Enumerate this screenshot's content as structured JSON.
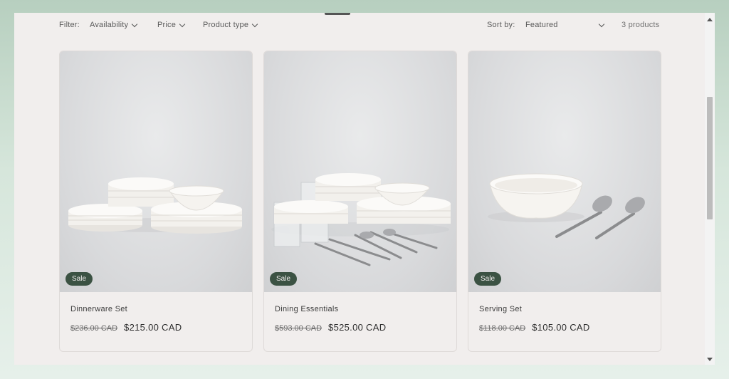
{
  "filters": {
    "label": "Filter:",
    "availability": "Availability",
    "price": "Price",
    "product_type": "Product type"
  },
  "sort": {
    "label": "Sort by:",
    "selected": "Featured"
  },
  "count": "3 products",
  "products": [
    {
      "badge": "Sale",
      "title": "Dinnerware Set",
      "old_price": "$236.00 CAD",
      "new_price": "$215.00 CAD"
    },
    {
      "badge": "Sale",
      "title": "Dining Essentials",
      "old_price": "$593.00 CAD",
      "new_price": "$525.00 CAD"
    },
    {
      "badge": "Sale",
      "title": "Serving Set",
      "old_price": "$118.00 CAD",
      "new_price": "$105.00 CAD"
    }
  ],
  "colors": {
    "badge_bg": "#3b5243",
    "page_bg": "#f1eeed",
    "background_gradient_top": "#b7cfbf",
    "background_gradient_bottom": "#e6f0ea"
  }
}
